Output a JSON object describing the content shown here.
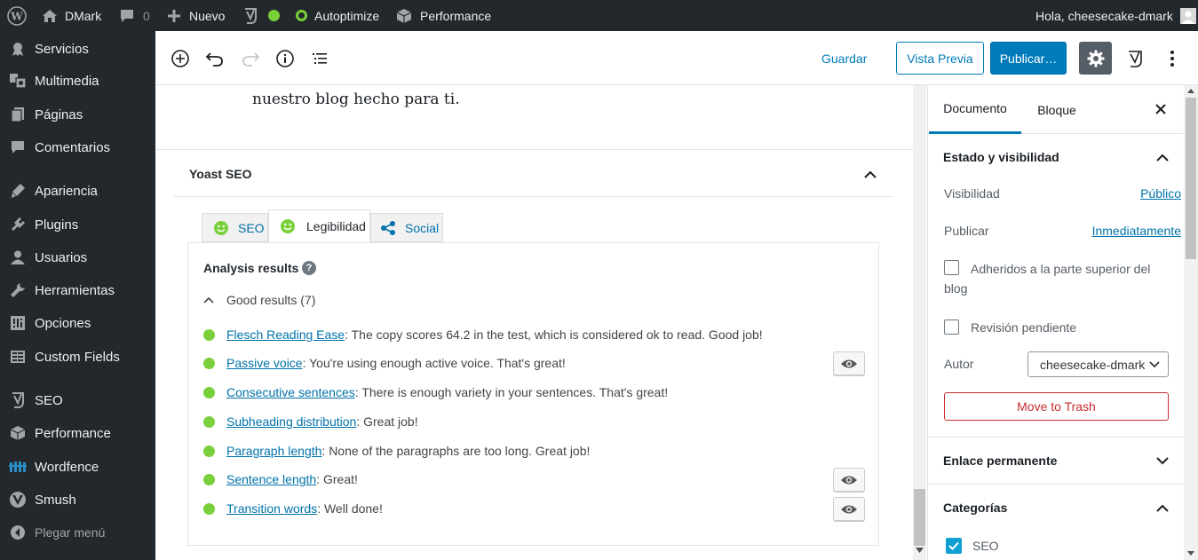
{
  "admin_bar": {
    "site_name": "DMark",
    "comments_count": "0",
    "new_label": "Nuevo",
    "autoptimize_label": "Autoptimize",
    "performance_label": "Performance",
    "greeting": "Hola, cheesecake-dmark"
  },
  "admin_menu": {
    "items": [
      {
        "label": "Servicios",
        "icon": "services-icon"
      },
      {
        "label": "Multimedia",
        "icon": "media-icon"
      },
      {
        "label": "Páginas",
        "icon": "pages-icon"
      },
      {
        "label": "Comentarios",
        "icon": "comments-icon"
      },
      {
        "label": "Apariencia",
        "icon": "appearance-icon"
      },
      {
        "label": "Plugins",
        "icon": "plugins-icon"
      },
      {
        "label": "Usuarios",
        "icon": "users-icon"
      },
      {
        "label": "Herramientas",
        "icon": "tools-icon"
      },
      {
        "label": "Opciones",
        "icon": "settings-icon"
      },
      {
        "label": "Custom Fields",
        "icon": "custom-fields-icon"
      },
      {
        "label": "SEO",
        "icon": "yoast-icon"
      },
      {
        "label": "Performance",
        "icon": "performance-icon"
      },
      {
        "label": "Wordfence",
        "icon": "wordfence-icon"
      },
      {
        "label": "Smush",
        "icon": "smush-icon"
      },
      {
        "label": "Plegar menú",
        "icon": "collapse-icon"
      }
    ]
  },
  "toolbar": {
    "save_label": "Guardar",
    "preview_label": "Vista Previa",
    "publish_label": "Publicar…"
  },
  "content": {
    "paragraph_text": "nuestro blog hecho para ti."
  },
  "yoast": {
    "title": "Yoast SEO",
    "tabs": [
      {
        "label": "SEO"
      },
      {
        "label": "Legibilidad"
      },
      {
        "label": "Social"
      }
    ],
    "analysis_title": "Analysis results",
    "help_glyph": "?",
    "good_results_label": "Good results (7)",
    "results": [
      {
        "link": "Flesch Reading Ease",
        "text": ": The copy scores 64.2 in the test, which is considered ok to read. Good job!"
      },
      {
        "link": "Passive voice",
        "text": ": You're using enough active voice. That's great!"
      },
      {
        "link": "Consecutive sentences",
        "text": ": There is enough variety in your sentences. That's great!"
      },
      {
        "link": "Subheading distribution",
        "text": ": Great job!"
      },
      {
        "link": "Paragraph length",
        "text": ": None of the paragraphs are too long. Great job!"
      },
      {
        "link": "Sentence length",
        "text": ": Great!"
      },
      {
        "link": "Transition words",
        "text": ": Well done!"
      }
    ]
  },
  "sidebar": {
    "tab_document": "Documento",
    "tab_block": "Bloque",
    "status_panel_title": "Estado y visibilidad",
    "visibility_label": "Visibilidad",
    "visibility_value": "Público",
    "publish_label": "Publicar",
    "publish_value": "Inmediatamente",
    "sticky_label": "Adheridos a la parte superior del blog",
    "pending_label": "Revisión pendiente",
    "author_label": "Autor",
    "author_value": "cheesecake-dmark",
    "trash_label": "Move to Trash",
    "permalink_title": "Enlace permanente",
    "categories_title": "Categorías",
    "category_seo": "SEO"
  },
  "colors": {
    "admin_dark": "#23282d",
    "wp_blue": "#007cba",
    "good_green": "#7ad03a",
    "trash_red": "#c92c2c"
  }
}
